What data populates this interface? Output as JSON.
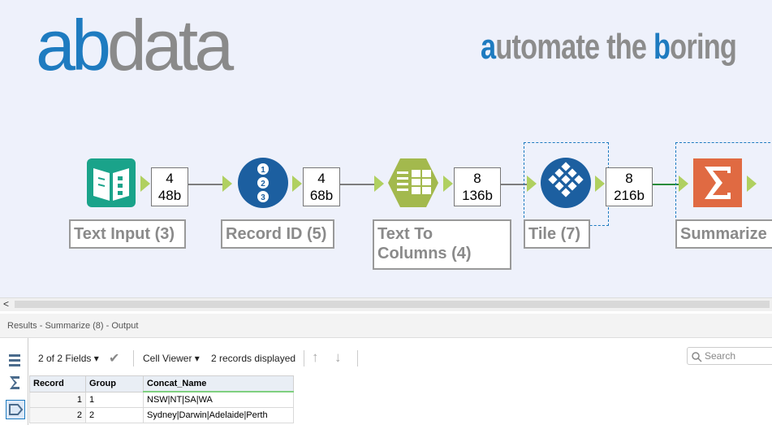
{
  "logo": {
    "ab": "ab",
    "data": "data"
  },
  "tagline": {
    "a": "a",
    "rest1": "utomate the ",
    "b": "b",
    "rest2": "oring"
  },
  "tools": [
    {
      "label": "Text Input (3)",
      "count": "4",
      "size": "48b",
      "icon": "book-icon",
      "color": "#1aa38a"
    },
    {
      "label": "Record ID (5)",
      "count": "4",
      "size": "68b",
      "icon": "record-id-icon",
      "color": "#1c5fa0"
    },
    {
      "label": "Text To Columns (4)",
      "count": "8",
      "size": "136b",
      "icon": "text-to-columns-icon",
      "color": "#a3b94d"
    },
    {
      "label": "Tile (7)",
      "count": "8",
      "size": "216b",
      "icon": "tile-icon",
      "color": "#1c5fa0"
    },
    {
      "label": "Summarize (",
      "icon": "sigma-icon",
      "color": "#e06a42"
    }
  ],
  "results": {
    "title": "Results - Summarize (8) - Output"
  },
  "toolbar": {
    "fields": "2 of 2 Fields",
    "cell_viewer": "Cell Viewer",
    "records": "2 records displayed",
    "search_placeholder": "Search"
  },
  "table": {
    "headers": [
      "Record",
      "Group",
      "Concat_Name"
    ],
    "rows": [
      [
        "1",
        "1",
        "NSW|NT|SA|WA"
      ],
      [
        "2",
        "2",
        "Sydney|Darwin|Adelaide|Perth"
      ]
    ]
  }
}
